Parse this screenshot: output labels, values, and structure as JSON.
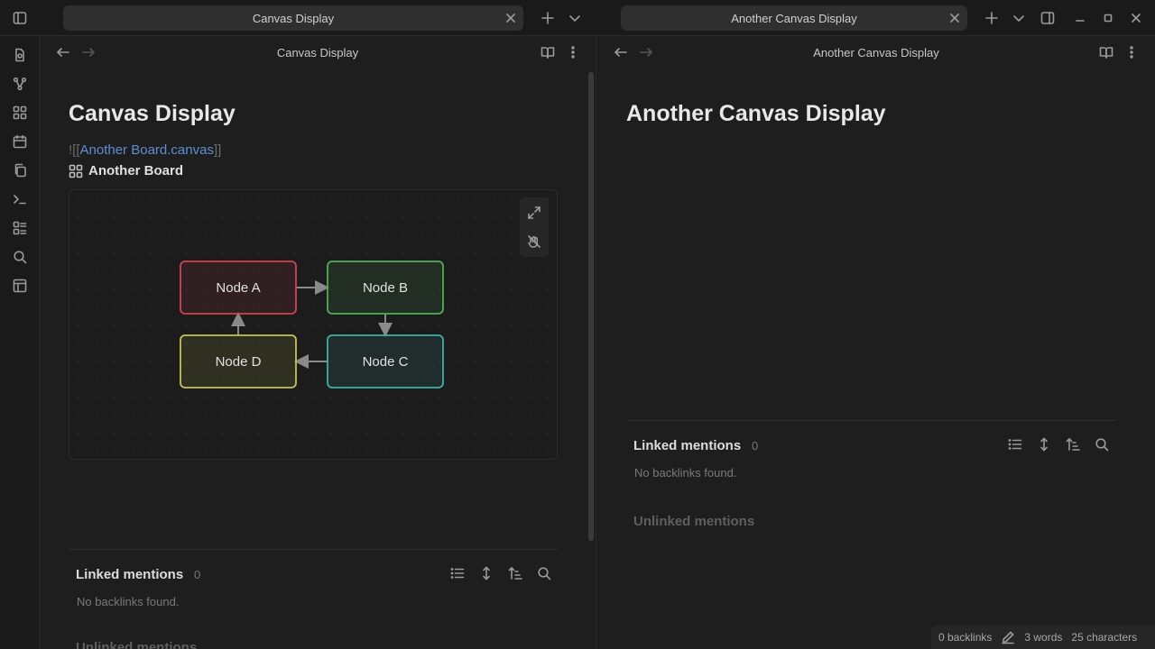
{
  "tabs": [
    {
      "title": "Canvas Display"
    },
    {
      "title": "Another Canvas Display"
    }
  ],
  "left_pane": {
    "header_title": "Canvas Display",
    "note_title": "Canvas Display",
    "embed": {
      "prefix": "![[",
      "link_text": "Another Board.canvas",
      "suffix": "]]",
      "heading": "Another Board"
    },
    "canvas": {
      "nodes": [
        {
          "id": "A",
          "label": "Node A",
          "color": "#d0434e"
        },
        {
          "id": "B",
          "label": "Node B",
          "color": "#4fae57"
        },
        {
          "id": "C",
          "label": "Node C",
          "color": "#3fb0a3"
        },
        {
          "id": "D",
          "label": "Node D",
          "color": "#c4c452"
        }
      ],
      "edges": [
        [
          "A",
          "B"
        ],
        [
          "B",
          "C"
        ],
        [
          "C",
          "D"
        ],
        [
          "D",
          "A"
        ]
      ]
    },
    "linked_mentions": {
      "title": "Linked mentions",
      "count": "0",
      "empty": "No backlinks found."
    },
    "unlinked_mentions": "Unlinked mentions"
  },
  "right_pane": {
    "header_title": "Another Canvas Display",
    "note_title": "Another Canvas Display",
    "linked_mentions": {
      "title": "Linked mentions",
      "count": "0",
      "empty": "No backlinks found."
    },
    "unlinked_mentions": "Unlinked mentions"
  },
  "status_bar": {
    "backlinks": "0 backlinks",
    "words": "3 words",
    "characters": "25 characters"
  }
}
